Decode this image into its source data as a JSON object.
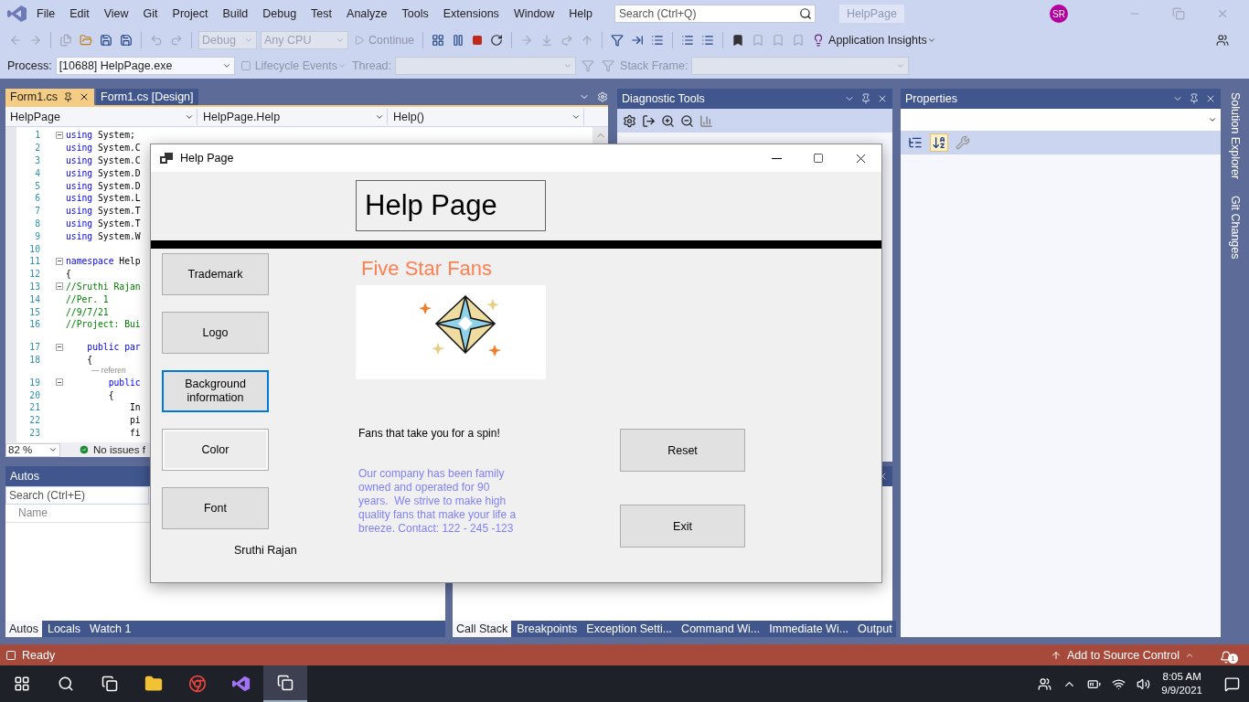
{
  "menu_bar": {
    "items": [
      "File",
      "Edit",
      "View",
      "Git",
      "Project",
      "Build",
      "Debug",
      "Test",
      "Analyze",
      "Tools",
      "Extensions",
      "Window",
      "Help"
    ],
    "search": {
      "placeholder": "Search (Ctrl+Q)"
    },
    "solution_name": "HelpPage",
    "avatar": "SR"
  },
  "toolbar": {
    "configuration": "Debug",
    "platform": "Any CPU",
    "continue": "Continue",
    "insights": "Application Insights"
  },
  "debug_location": {
    "process_label": "Process:",
    "process": "[10688] HelpPage.exe",
    "lifecycle": "Lifecycle Events",
    "thread_label": "Thread:",
    "stack_frame_label": "Stack Frame:"
  },
  "editor": {
    "tabs": [
      {
        "label": "Form1.cs",
        "selected": true
      },
      {
        "label": "Form1.cs [Design]",
        "selected": false
      }
    ],
    "nav": [
      "HelpPage",
      "HelpPage.Help",
      "Help()"
    ],
    "lines": [
      {
        "kind": "code",
        "number": "1",
        "foldable": true,
        "tokens": [
          {
            "kind": "keyword",
            "text": "using"
          },
          {
            "kind": "plain",
            "text": " System;"
          }
        ]
      },
      {
        "kind": "code",
        "number": "2",
        "foldable": false,
        "tokens": [
          {
            "kind": "keyword",
            "text": "using"
          },
          {
            "kind": "plain",
            "text": " System.C"
          }
        ]
      },
      {
        "kind": "code",
        "number": "3",
        "foldable": false,
        "tokens": [
          {
            "kind": "keyword",
            "text": "using"
          },
          {
            "kind": "plain",
            "text": " System.C"
          }
        ]
      },
      {
        "kind": "code",
        "number": "4",
        "foldable": false,
        "tokens": [
          {
            "kind": "keyword",
            "text": "using"
          },
          {
            "kind": "plain",
            "text": " System.D"
          }
        ]
      },
      {
        "kind": "code",
        "number": "5",
        "foldable": false,
        "tokens": [
          {
            "kind": "keyword",
            "text": "using"
          },
          {
            "kind": "plain",
            "text": " System.D"
          }
        ]
      },
      {
        "kind": "code",
        "number": "6",
        "foldable": false,
        "tokens": [
          {
            "kind": "keyword",
            "text": "using"
          },
          {
            "kind": "plain",
            "text": " System.L"
          }
        ]
      },
      {
        "kind": "code",
        "number": "7",
        "foldable": false,
        "tokens": [
          {
            "kind": "keyword",
            "text": "using"
          },
          {
            "kind": "plain",
            "text": " System.T"
          }
        ]
      },
      {
        "kind": "code",
        "number": "8",
        "foldable": false,
        "tokens": [
          {
            "kind": "keyword",
            "text": "using"
          },
          {
            "kind": "plain",
            "text": " System.T"
          }
        ]
      },
      {
        "kind": "code",
        "number": "9",
        "foldable": false,
        "tokens": [
          {
            "kind": "keyword",
            "text": "using"
          },
          {
            "kind": "plain",
            "text": " System.W"
          }
        ]
      },
      {
        "kind": "code",
        "number": "10",
        "foldable": false
      },
      {
        "kind": "code",
        "number": "11",
        "foldable": true,
        "tokens": [
          {
            "kind": "keyword",
            "text": "namespace"
          },
          {
            "kind": "plain",
            "text": " Help"
          }
        ]
      },
      {
        "kind": "code",
        "number": "12",
        "foldable": false,
        "tokens": [
          {
            "kind": "plain",
            "text": "{"
          }
        ]
      },
      {
        "kind": "code",
        "number": "13",
        "foldable": true,
        "tokens": [
          {
            "kind": "comment",
            "text": "//Sruthi Rajan"
          }
        ]
      },
      {
        "kind": "code",
        "number": "14",
        "foldable": false,
        "tokens": [
          {
            "kind": "comment",
            "text": "//Per. 1"
          }
        ]
      },
      {
        "kind": "code",
        "number": "15",
        "foldable": false,
        "tokens": [
          {
            "kind": "comment",
            "text": "//9/7/21"
          }
        ]
      },
      {
        "kind": "code",
        "number": "16",
        "foldable": false,
        "tokens": [
          {
            "kind": "comment",
            "text": "//Project: Bui"
          }
        ]
      },
      {
        "kind": "codelens"
      },
      {
        "kind": "code",
        "number": "17",
        "foldable": true,
        "tokens": [
          {
            "kind": "keyword",
            "text": "    public par"
          }
        ]
      },
      {
        "kind": "code",
        "number": "18",
        "foldable": false,
        "tokens": [
          {
            "kind": "plain",
            "text": "    {"
          }
        ]
      },
      {
        "kind": "codelens",
        "text": "— referen"
      },
      {
        "kind": "code",
        "number": "19",
        "foldable": true,
        "tokens": [
          {
            "kind": "keyword",
            "text": "        public"
          }
        ]
      },
      {
        "kind": "code",
        "number": "20",
        "foldable": false,
        "tokens": [
          {
            "kind": "plain",
            "text": "        {"
          }
        ]
      },
      {
        "kind": "code",
        "number": "21",
        "foldable": false,
        "tokens": [
          {
            "kind": "plain",
            "text": "            In"
          }
        ]
      },
      {
        "kind": "code",
        "number": "22",
        "foldable": false,
        "tokens": [
          {
            "kind": "plain",
            "text": "            pi"
          }
        ]
      },
      {
        "kind": "code",
        "number": "23",
        "foldable": false,
        "tokens": [
          {
            "kind": "plain",
            "text": "            fi"
          }
        ]
      }
    ],
    "zoom": "82 %",
    "issues": "No issues f"
  },
  "diagnostic_tools": {
    "title": "Diagnostic Tools"
  },
  "properties": {
    "title": "Properties",
    "tools": [
      {
        "kind": "categorized",
        "selected": false
      },
      {
        "kind": "alphabetical",
        "selected": true
      },
      {
        "kind": "pages",
        "selected": false
      }
    ]
  },
  "side_tabs": [
    "Solution Explorer",
    "Git Changes"
  ],
  "autos": {
    "title": "Autos",
    "search": {
      "placeholder": "Search (Ctrl+E)"
    },
    "column": "Name",
    "tabs": [
      {
        "label": "Autos",
        "selected": true
      },
      {
        "label": "Locals",
        "selected": false
      },
      {
        "label": "Watch 1",
        "selected": false
      }
    ]
  },
  "debug_tabs": [
    {
      "label": "Call Stack",
      "selected": true
    },
    {
      "label": "Breakpoints",
      "selected": false
    },
    {
      "label": "Exception Setti...",
      "selected": false
    },
    {
      "label": "Command Wi...",
      "selected": false
    },
    {
      "label": "Immediate Wi...",
      "selected": false
    },
    {
      "label": "Output",
      "selected": false
    }
  ],
  "status_bar": {
    "state": "Ready",
    "source_control": "Add to Source Control",
    "notifications": "1"
  },
  "taskbar": {
    "time": "8:05 AM",
    "date": "9/9/2021"
  },
  "form": {
    "title": "Help Page",
    "heading": "Help Page",
    "buttons": [
      {
        "label": "Trademark",
        "focused": false,
        "hovered": false
      },
      {
        "label": "Logo",
        "focused": false,
        "hovered": false
      },
      {
        "label": "Background information",
        "focused": true,
        "hovered": false
      },
      {
        "label": "Color",
        "focused": false,
        "hovered": true
      },
      {
        "label": "Font",
        "focused": false,
        "hovered": false
      }
    ],
    "author": "Sruthi Rajan",
    "brand": "Five Star Fans",
    "tagline": "Fans that take you for a spin!",
    "about": "Our company has been family owned and operated for 90 years.  We strive to make high quality fans that make your life a breeze. Contact: 122 - 245 -123",
    "actions": [
      "Reset",
      "Exit"
    ]
  }
}
